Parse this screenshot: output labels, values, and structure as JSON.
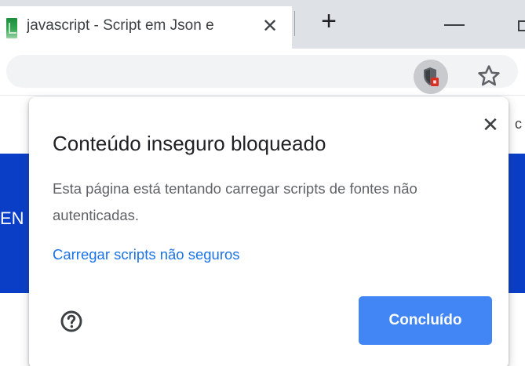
{
  "tab": {
    "title": "javascript - Script em Json e",
    "close_glyph": "✕"
  },
  "tabstrip": {
    "new_tab_glyph": "+"
  },
  "toolbar": {
    "shield_icon": "shield-blocked-icon",
    "star_icon": "star-icon"
  },
  "page": {
    "partial_left_text": "EN",
    "partial_right_text": "c"
  },
  "bubble": {
    "close_glyph": "✕",
    "title": "Conteúdo inseguro bloqueado",
    "message": "Esta página está tentando carregar scripts de fontes não autenticadas.",
    "link": "Carregar scripts não seguros",
    "help_icon": "help-circle-icon",
    "done_label": "Concluído"
  },
  "colors": {
    "accent_blue": "#4285f4",
    "link_blue": "#1a73e8",
    "page_band": "#0a3ec6",
    "tabstrip_bg": "#dee1e6",
    "blocked_badge": "#d93025"
  }
}
